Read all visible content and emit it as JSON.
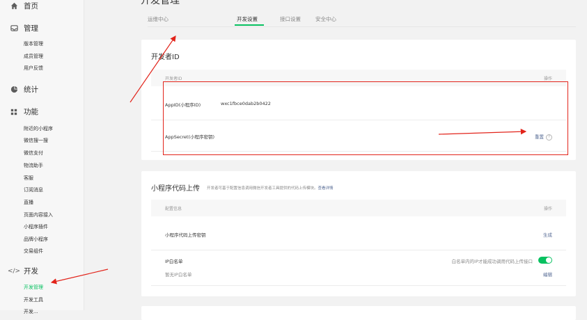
{
  "sidebar": {
    "home": {
      "label": "首页",
      "icon": "home-icon"
    },
    "manage": {
      "label": "管理",
      "icon": "inbox-icon",
      "items": [
        "版本管理",
        "成员管理",
        "用户反馈"
      ]
    },
    "stats": {
      "label": "统计",
      "icon": "pie-chart-icon"
    },
    "features": {
      "label": "功能",
      "icon": "grid-icon",
      "items": [
        "附近的小程序",
        "微信搜一搜",
        "微信支付",
        "物流助手",
        "客服",
        "订阅消息",
        "直播",
        "页面内容接入",
        "小程序插件",
        "品牌小程序",
        "交易组件"
      ]
    },
    "dev": {
      "label": "开发",
      "icon": "code-icon",
      "items": [
        "开发管理",
        "开发工具",
        "开发..."
      ],
      "active_index": 0
    }
  },
  "main": {
    "title": "开发管理",
    "tabs": [
      "运维中心",
      "开发设置",
      "接口设置",
      "安全中心"
    ],
    "active_tab": 1
  },
  "developer_id": {
    "title": "开发者ID",
    "col_left": "开发者ID",
    "col_right": "操作",
    "rows": [
      {
        "label": "AppID(小程序ID)",
        "value": "wxc1fbce0dab2b0422"
      },
      {
        "label": "AppSecret(小程序密钥)",
        "action": "重置"
      }
    ]
  },
  "code_upload": {
    "title": "小程序代码上传",
    "desc": "开发者可基于配置信息调用微信开发者工具提供的代码上传模块。",
    "desc_link": "查看详情",
    "col_left": "配置信息",
    "col_right": "操作",
    "key_row": {
      "label": "小程序代码上传密钥",
      "action": "生成"
    },
    "ip_row": {
      "label": "IP白名单",
      "sub": "暂无IP白名单",
      "toggle_text": "白名单内的IP才能成功调用代码上传接口",
      "toggle_on": true,
      "action": "编辑"
    }
  },
  "colors": {
    "accent": "#07c160",
    "link": "#576b95",
    "annotation": "#e2231a"
  }
}
